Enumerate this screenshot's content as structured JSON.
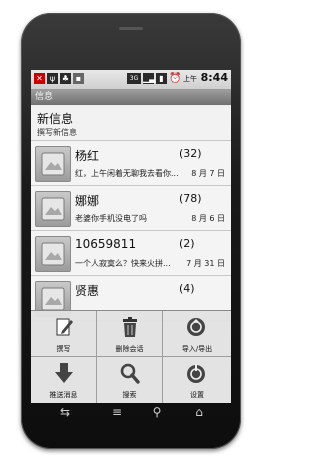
{
  "status_bar": {
    "time": "8:44",
    "ampm": "上午",
    "network": "3G"
  },
  "title_bar": {
    "title": "信息"
  },
  "new_message": {
    "title": "新信息",
    "subtitle": "撰写新信息"
  },
  "threads": [
    {
      "name": "杨红",
      "count": "(32)",
      "snippet": "红，上午闲着无聊我去看你...",
      "date": "8 月 7 日"
    },
    {
      "name": "娜娜",
      "count": "(78)",
      "snippet": "老婆你手机没电了吗",
      "date": "8 月 6 日"
    },
    {
      "name": "10659811",
      "count": "(2)",
      "snippet": "一个人寂寞么？快来火拼...",
      "date": "7 月 31 日"
    },
    {
      "name": "贤惠",
      "count": "(4)",
      "snippet": "",
      "date": ""
    }
  ],
  "menu": {
    "items": [
      {
        "label": "撰写",
        "icon": "compose-icon"
      },
      {
        "label": "删除会话",
        "icon": "trash-icon"
      },
      {
        "label": "导入/导出",
        "icon": "import-export-icon"
      },
      {
        "label": "推送消息",
        "icon": "push-download-icon"
      },
      {
        "label": "搜索",
        "icon": "search-icon"
      },
      {
        "label": "设置",
        "icon": "settings-icon"
      }
    ]
  },
  "colors": {
    "menu_icon": "#3a3a3a",
    "title_bar": "#7d7d7d"
  }
}
